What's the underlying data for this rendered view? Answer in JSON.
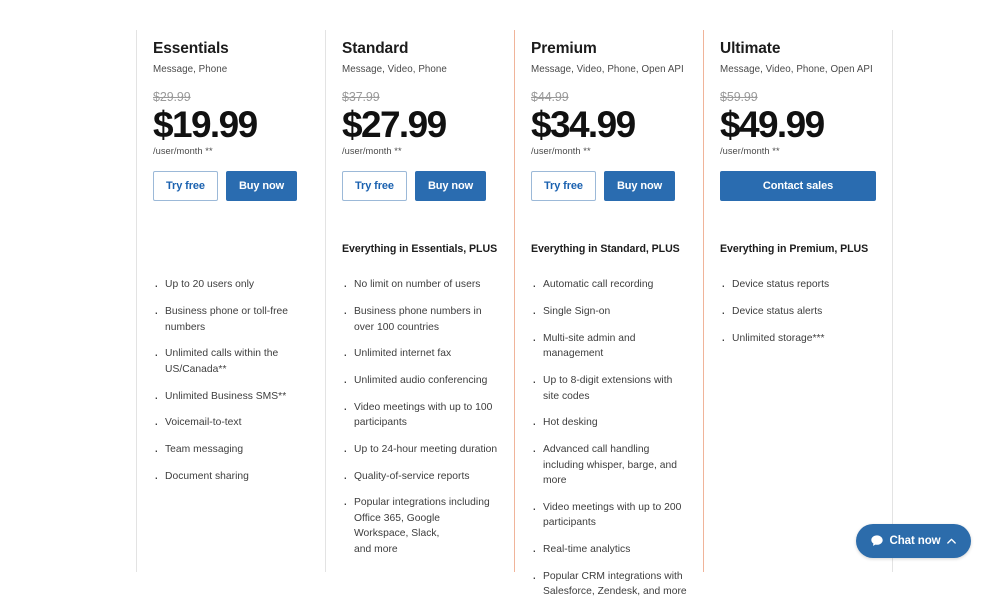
{
  "page": {
    "background": "#ffffff",
    "accent_primary": "#2a6cb0",
    "accent_secondary_text": "#1b62b0",
    "highlight_border": "#f0b49a",
    "divider": "#e3e3e3"
  },
  "plans": [
    {
      "name": "Essentials",
      "tagline": "Message, Phone",
      "price_old": "$29.99",
      "price_now": "$19.99",
      "price_unit": "/user/month **",
      "buttons": [
        {
          "label": "Try free",
          "style": "secondary",
          "name": "try-free-button"
        },
        {
          "label": "Buy now",
          "style": "primary",
          "name": "buy-now-button"
        }
      ],
      "plus_header": "",
      "highlight": false,
      "features": [
        "Up to 20 users only",
        "Business phone or toll-free numbers",
        "Unlimited calls within the US/Canada**",
        "Unlimited Business SMS**",
        "Voicemail-to-text",
        "Team messaging",
        "Document sharing"
      ]
    },
    {
      "name": "Standard",
      "tagline": "Message, Video, Phone",
      "price_old": "$37.99",
      "price_now": "$27.99",
      "price_unit": "/user/month **",
      "buttons": [
        {
          "label": "Try free",
          "style": "secondary",
          "name": "try-free-button"
        },
        {
          "label": "Buy now",
          "style": "primary",
          "name": "buy-now-button"
        }
      ],
      "plus_header": "Everything in Essentials, PLUS",
      "highlight": false,
      "features": [
        "No limit on number of users",
        "Business phone numbers in over 100 countries",
        "Unlimited internet fax",
        "Unlimited audio conferencing",
        "Video meetings with up to 100 participants",
        "Up to 24-hour meeting duration",
        "Quality-of-service reports",
        "Popular integrations including\nOffice 365, Google\nWorkspace, Slack,\nand more"
      ]
    },
    {
      "name": "Premium",
      "tagline": "Message, Video, Phone, Open API",
      "price_old": "$44.99",
      "price_now": "$34.99",
      "price_unit": "/user/month **",
      "buttons": [
        {
          "label": "Try free",
          "style": "secondary",
          "name": "try-free-button"
        },
        {
          "label": "Buy now",
          "style": "primary",
          "name": "buy-now-button"
        }
      ],
      "plus_header": "Everything in Standard, PLUS",
      "highlight": true,
      "features": [
        "Automatic call recording",
        "Single Sign-on",
        "Multi-site admin and management",
        "Up to 8-digit extensions with site codes",
        "Hot desking",
        "Advanced call handling including whisper, barge, and more",
        "Video meetings with up to 200 participants",
        "Real-time analytics",
        "Popular CRM integrations with Salesforce, Zendesk, and more"
      ]
    },
    {
      "name": "Ultimate",
      "tagline": "Message, Video, Phone, Open API",
      "price_old": "$59.99",
      "price_now": "$49.99",
      "price_unit": "/user/month **",
      "buttons": [
        {
          "label": "Contact sales",
          "style": "primary-wide",
          "name": "contact-sales-button"
        }
      ],
      "plus_header": "Everything in Premium, PLUS",
      "highlight": false,
      "features": [
        "Device status reports",
        "Device status alerts",
        "Unlimited storage***"
      ]
    }
  ],
  "chat_widget": {
    "label": "Chat now",
    "bubble_icon": "chat-bubble-icon",
    "chevron_icon": "chevron-up-icon"
  }
}
